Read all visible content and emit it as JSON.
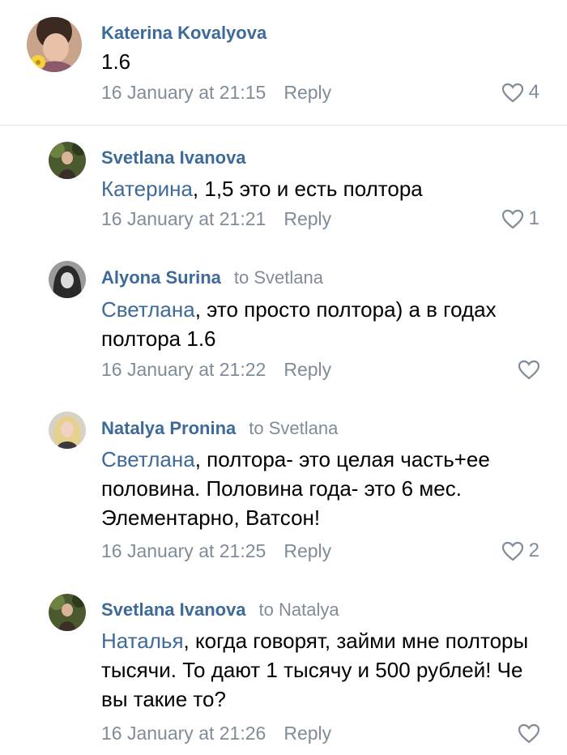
{
  "comments": [
    {
      "author": "Katerina Kovalyova",
      "to": "",
      "mention": "",
      "text": "1.6",
      "time": "16 January at 21:15",
      "reply": "Reply",
      "likes": "4"
    },
    {
      "author": "Svetlana Ivanova",
      "to": "",
      "mention": "Катерина",
      "text": ", 1,5 это и есть полтора",
      "time": "16 January at 21:21",
      "reply": "Reply",
      "likes": "1"
    },
    {
      "author": "Alyona Surina",
      "to": "to Svetlana",
      "mention": "Светлана",
      "text": ", это просто полтора) а в годах полтора 1.6",
      "time": "16 January at 21:22",
      "reply": "Reply",
      "likes": ""
    },
    {
      "author": "Natalya Pronina",
      "to": "to Svetlana",
      "mention": "Светлана",
      "text": ", полтора- это целая часть+ее половина. Половина года- это 6 мес. Элементарно, Ватсон!",
      "time": "16 January at 21:25",
      "reply": "Reply",
      "likes": "2"
    },
    {
      "author": "Svetlana Ivanova",
      "to": "to Natalya",
      "mention": "Наталья",
      "text": ", когда говорят, займи мне полторы тысячи. То дают 1 тысячу и 500 рублей! Че вы такие то?",
      "time": "16 January at 21:26",
      "reply": "Reply",
      "likes": ""
    }
  ],
  "colors": {
    "link": "#3e6a99",
    "secondary": "#818c99",
    "text": "#000000",
    "divider": "#e3e5e8"
  },
  "icons": {
    "like": "heart-outline-icon",
    "avatar": "user-photo"
  }
}
